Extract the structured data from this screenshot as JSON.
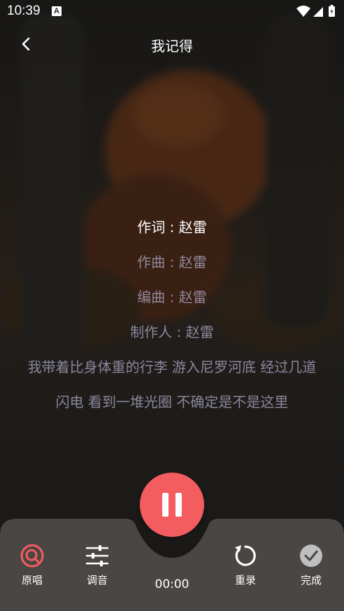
{
  "status_bar": {
    "time": "10:39",
    "notification_icon": "A"
  },
  "header": {
    "title": "我记得",
    "back_icon": "chevron-left-icon"
  },
  "lyrics": {
    "lines": [
      "作词 : 赵雷",
      "作曲 : 赵雷",
      "编曲 : 赵雷",
      "制作人 : 赵雷"
    ],
    "paragraph": "我带着比身体重的行李 游入尼罗河底  经过几道闪电  看到一堆光圈 不确定是不是这里"
  },
  "controls": {
    "original_vocal_label": "原唱",
    "tune_label": "调音",
    "rerecord_label": "重录",
    "finish_label": "完成",
    "timer": "00:00"
  },
  "colors": {
    "accent": "#f45d5f",
    "bottom_bar": "#4a4644",
    "done_icon_bg": "#bfbfbf"
  }
}
